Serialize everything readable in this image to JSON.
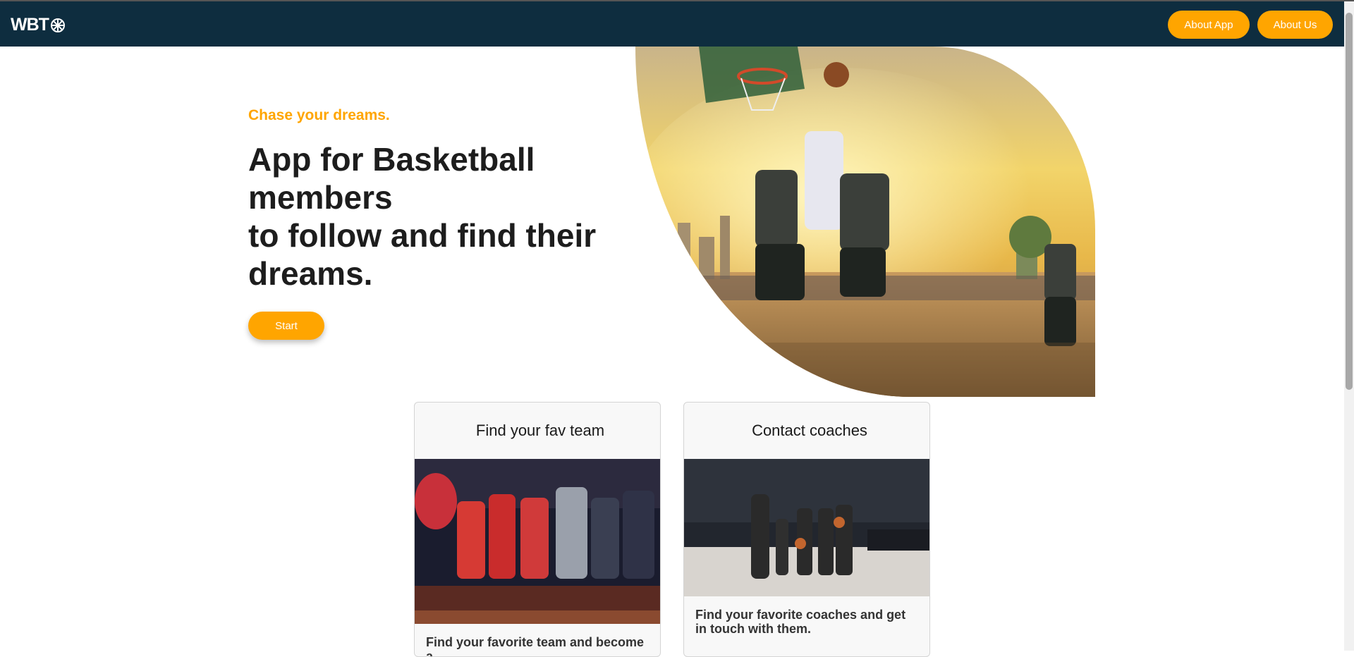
{
  "navbar": {
    "logo_text": "WBT",
    "logo_icon": "basketball-icon",
    "about_app_label": "About App",
    "about_us_label": "About Us",
    "background_color": "#0e2d3f",
    "accent_color": "#ffa500"
  },
  "hero": {
    "tagline": "Chase your dreams.",
    "headline_line1": "App for Basketball members",
    "headline_line2": "to follow and find their dreams.",
    "start_label": "Start",
    "image_description": "basketball-players-jumping-photo"
  },
  "cards": [
    {
      "title": "Find your fav team",
      "text": "Find your favorite team and become a",
      "image": "basketball-team-huddle-photo"
    },
    {
      "title": "Contact coaches",
      "text": "Find your favorite coaches and get in touch with them.",
      "image": "coach-with-kids-photo"
    }
  ]
}
